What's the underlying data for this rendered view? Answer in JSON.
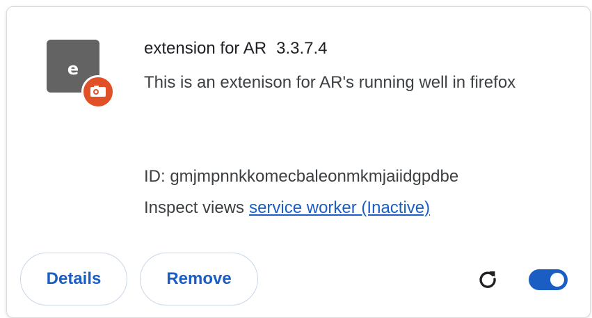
{
  "extension": {
    "icon_letter": "e",
    "icon_badge": "camera-badge-icon",
    "name": "extension for AR",
    "version": "3.3.7.4",
    "description": "This is an extenison for AR's running well in firefox",
    "id_text": "ID: gmjmpnnkkomecbaleonmkmjaiidgpdbe",
    "inspect_label": "Inspect views",
    "inspect_link": "service worker (Inactive)",
    "enabled": true
  },
  "buttons": {
    "details_label": "Details",
    "remove_label": "Remove"
  },
  "icons": {
    "reload": "reload-icon",
    "toggle": "enable-toggle"
  },
  "colors": {
    "accent": "#1a5ec4",
    "icon_bg": "#636363",
    "badge": "#e05128",
    "text": "#202124"
  }
}
